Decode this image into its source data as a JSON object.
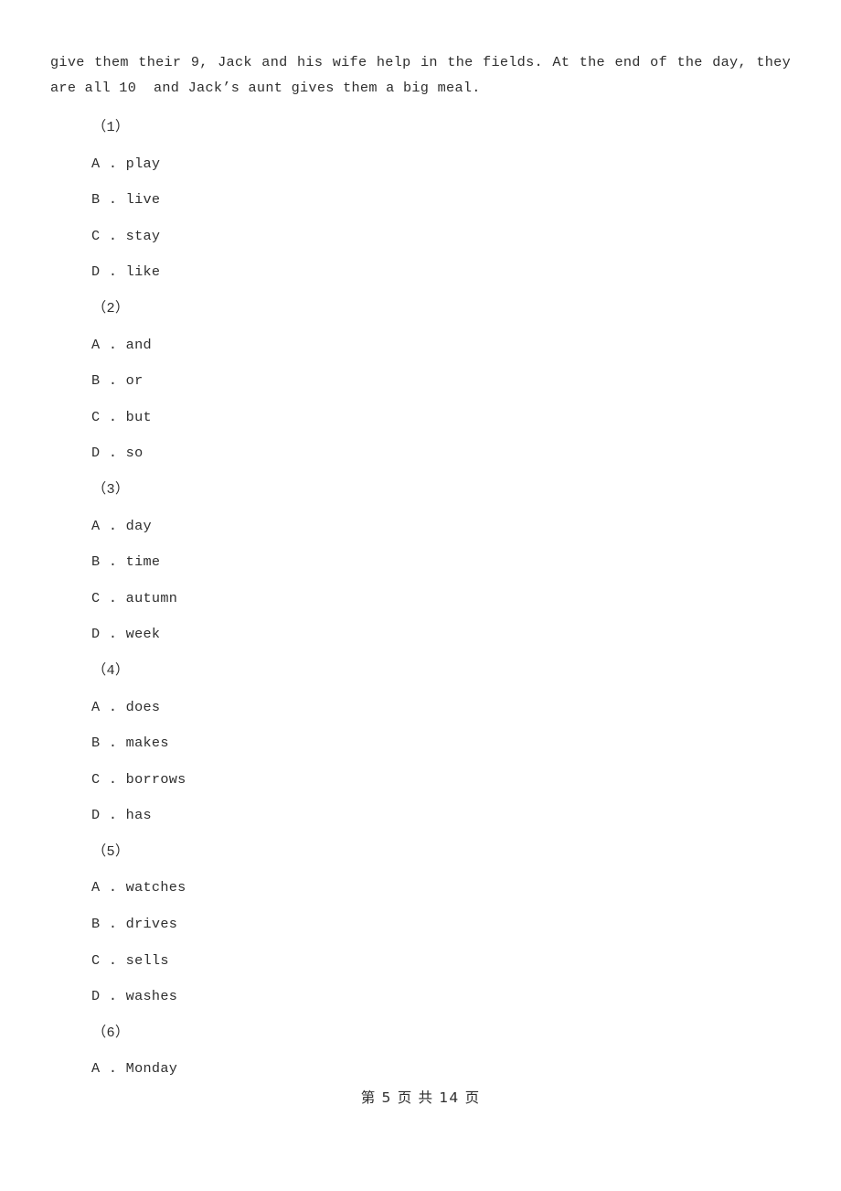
{
  "document": {
    "passage": "give them their 9, Jack and his wife help in the fields. At the end of the day, they are all 10  and Jack’s aunt gives them a big meal.",
    "questions": [
      {
        "number": "（1）",
        "options": [
          {
            "letter": "A",
            "separator": " . ",
            "text": "play"
          },
          {
            "letter": "B",
            "separator": " . ",
            "text": "live"
          },
          {
            "letter": "C",
            "separator": " . ",
            "text": "stay"
          },
          {
            "letter": "D",
            "separator": " . ",
            "text": "like"
          }
        ]
      },
      {
        "number": "（2）",
        "options": [
          {
            "letter": "A",
            "separator": " . ",
            "text": "and"
          },
          {
            "letter": "B",
            "separator": " . ",
            "text": "or"
          },
          {
            "letter": "C",
            "separator": " . ",
            "text": "but"
          },
          {
            "letter": "D",
            "separator": " . ",
            "text": "so"
          }
        ]
      },
      {
        "number": "（3）",
        "options": [
          {
            "letter": "A",
            "separator": " . ",
            "text": "day"
          },
          {
            "letter": "B",
            "separator": " . ",
            "text": "time"
          },
          {
            "letter": "C",
            "separator": " . ",
            "text": "autumn"
          },
          {
            "letter": "D",
            "separator": " . ",
            "text": "week"
          }
        ]
      },
      {
        "number": "（4）",
        "options": [
          {
            "letter": "A",
            "separator": " . ",
            "text": "does"
          },
          {
            "letter": "B",
            "separator": " . ",
            "text": "makes"
          },
          {
            "letter": "C",
            "separator": " . ",
            "text": "borrows"
          },
          {
            "letter": "D",
            "separator": " . ",
            "text": "has"
          }
        ]
      },
      {
        "number": "（5）",
        "options": [
          {
            "letter": "A",
            "separator": " . ",
            "text": "watches"
          },
          {
            "letter": "B",
            "separator": " . ",
            "text": "drives"
          },
          {
            "letter": "C",
            "separator": " . ",
            "text": "sells"
          },
          {
            "letter": "D",
            "separator": " . ",
            "text": "washes"
          }
        ]
      },
      {
        "number": "（6）",
        "options": [
          {
            "letter": "A",
            "separator": " . ",
            "text": "Monday"
          }
        ]
      }
    ],
    "footer": {
      "text": "第 5 页 共 14 页",
      "current_page": "5",
      "total_pages": "14"
    }
  }
}
